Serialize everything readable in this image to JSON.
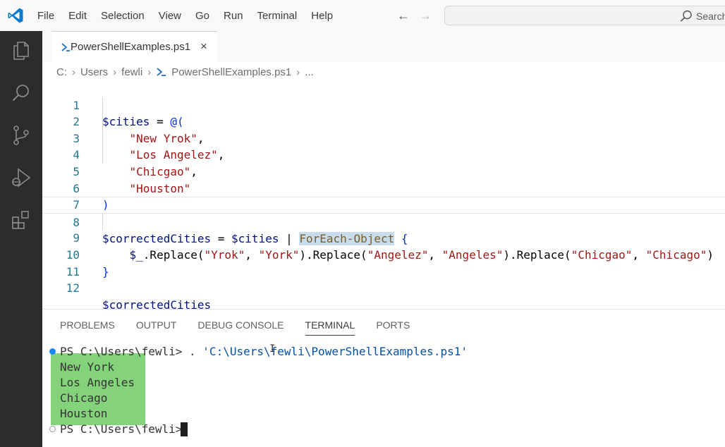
{
  "menu": [
    "File",
    "Edit",
    "Selection",
    "View",
    "Go",
    "Run",
    "Terminal",
    "Help"
  ],
  "search": {
    "label": "Search"
  },
  "tab": {
    "label": "PowerShellExamples.ps1",
    "close": "×"
  },
  "breadcrumb": [
    "C:",
    "Users",
    "fewli",
    "PowerShellExamples.ps1",
    "..."
  ],
  "breadcrumb_sep": "›",
  "editor": {
    "line_numbers": [
      "1",
      "2",
      "3",
      "4",
      "5",
      "6",
      "7",
      "8",
      "9",
      "10",
      "11",
      "12"
    ],
    "lines": {
      "l1_var": "$cities",
      "l1_op": " = ",
      "l1_br": "@(",
      "l2": "\"New Yrok\"",
      "l2c": ",",
      "l3": "\"Los Angelez\"",
      "l3c": ",",
      "l4": "\"Chicgao\"",
      "l4c": ",",
      "l5": "\"Houston\"",
      "l6": ")",
      "l8_var1": "$correctedCities",
      "l8_op": " = ",
      "l8_var2": "$cities",
      "l8_pipe": " | ",
      "l8_cmd": "ForEach-Object",
      "l8_sp": " ",
      "l8_br": "{",
      "l9_var": "$_",
      "l9_m1": ".Replace(",
      "l9_s1": "\"Yrok\"",
      "l9_c1": ", ",
      "l9_s2": "\"York\"",
      "l9_m2": ").Replace(",
      "l9_s3": "\"Angelez\"",
      "l9_c2": ", ",
      "l9_s4": "\"Angeles\"",
      "l9_m3": ").Replace(",
      "l9_s5": "\"Chicgao\"",
      "l9_c3": ", ",
      "l9_s6": "\"Chicago\"",
      "l9_end": ")",
      "l10": "}",
      "l12": "$correctedCities"
    }
  },
  "panel": {
    "tabs": [
      "PROBLEMS",
      "OUTPUT",
      "DEBUG CONSOLE",
      "TERMINAL",
      "PORTS"
    ],
    "active_tab": "TERMINAL"
  },
  "terminal": {
    "prompt1": "PS C:\\Users\\fewli> ",
    "cmd_dot": ". ",
    "cmd_path": "'C:\\Users\\fewli\\PowerShellExamples.ps1'",
    "output": [
      "New York",
      "Los Angeles",
      "Chicago",
      "Houston"
    ],
    "prompt2": "PS C:\\Users\\fewli> "
  },
  "colors": {
    "activity_bar": "#2c2c2c",
    "accent_blue": "#1a85ff",
    "output_highlight": "#84d27a"
  }
}
